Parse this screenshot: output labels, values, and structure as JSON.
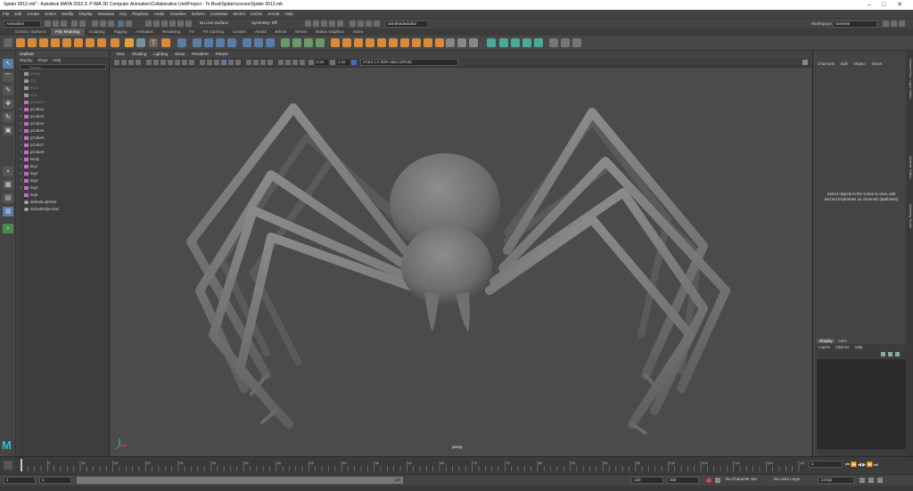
{
  "window": {
    "title": "Spider 0012.mb* - Autodesk MAYA 2022.3: P:\\MA 3D Computer Animation\\Collaborative Unit\\Project - To Beat\\Spider\\scenes\\Spider 0012.mb"
  },
  "menubar": [
    "File",
    "Edit",
    "Create",
    "Select",
    "Modify",
    "Display",
    "Windows",
    "Key",
    "Playback",
    "Audio",
    "Visualize",
    "Deform",
    "Constrain",
    "MASH",
    "Cache",
    "Arnold",
    "Help"
  ],
  "statusline": {
    "mode": "Animation",
    "live_surface": "No Live Surface",
    "symmetry": "Symmetry: Off",
    "user": "dorothedwards2",
    "workspace_label": "Workspace :",
    "workspace": "General"
  },
  "shelf_tabs": [
    "Curves / Surfaces",
    "Poly Modeling",
    "Sculpting",
    "Rigging",
    "Animation",
    "Rendering",
    "FX",
    "FX Caching",
    "Custom",
    "Arnold",
    "Bifrost",
    "MASH",
    "Motion Graphics",
    "XGen"
  ],
  "shelf_active": "Poly Modeling",
  "outliner": {
    "title": "Outliner",
    "menu": [
      "Display",
      "Show",
      "Help"
    ],
    "search_placeholder": "Search...",
    "items": [
      {
        "label": "persp",
        "dim": true,
        "icon": "camera-icon",
        "expandable": false
      },
      {
        "label": "top",
        "dim": true,
        "icon": "camera-icon",
        "expandable": false
      },
      {
        "label": "front",
        "dim": true,
        "icon": "camera-icon",
        "expandable": false
      },
      {
        "label": "side",
        "dim": true,
        "icon": "camera-icon",
        "expandable": false
      },
      {
        "label": "pCube1",
        "dim": true,
        "icon": "mesh-icon",
        "expandable": false
      },
      {
        "label": "pCube2",
        "dim": false,
        "icon": "mesh-icon",
        "expandable": true
      },
      {
        "label": "pCube3",
        "dim": false,
        "icon": "mesh-icon",
        "expandable": true
      },
      {
        "label": "pCube4",
        "dim": false,
        "icon": "mesh-icon",
        "expandable": true
      },
      {
        "label": "pCube5",
        "dim": false,
        "icon": "mesh-icon",
        "expandable": true
      },
      {
        "label": "pCube6",
        "dim": false,
        "icon": "mesh-icon",
        "expandable": true
      },
      {
        "label": "pCube7",
        "dim": false,
        "icon": "mesh-icon",
        "expandable": true
      },
      {
        "label": "pCube8",
        "dim": false,
        "icon": "mesh-icon",
        "expandable": true
      },
      {
        "label": "Body",
        "dim": false,
        "icon": "mesh-icon",
        "expandable": true
      },
      {
        "label": "leg1",
        "dim": false,
        "icon": "mesh-icon",
        "expandable": true
      },
      {
        "label": "leg2",
        "dim": false,
        "icon": "mesh-icon",
        "expandable": true
      },
      {
        "label": "leg3",
        "dim": false,
        "icon": "mesh-icon",
        "expandable": true
      },
      {
        "label": "leg4",
        "dim": false,
        "icon": "mesh-icon",
        "expandable": true
      },
      {
        "label": "leg5",
        "dim": false,
        "icon": "mesh-icon",
        "expandable": false
      },
      {
        "label": "defaultLightSet",
        "dim": false,
        "icon": "set-icon",
        "expandable": false
      },
      {
        "label": "defaultObjectSet",
        "dim": false,
        "icon": "set-icon",
        "expandable": false
      }
    ]
  },
  "viewport": {
    "menu": [
      "View",
      "Shading",
      "Lighting",
      "Show",
      "Renderer",
      "Panels"
    ],
    "exposure": "0.00",
    "gamma": "1.00",
    "color_space": "ACES 1.0 SDR-video (sRGB)",
    "camera_label": "persp"
  },
  "channel_box": {
    "menu": [
      "Channels",
      "Edit",
      "Object",
      "Show"
    ],
    "message": "Select objects in the scene to view, edit and set keyframes on channels (attributes)"
  },
  "layer_editor": {
    "tabs": [
      "Display",
      "Anim"
    ],
    "active_tab": "Display",
    "menu": [
      "Layers",
      "Options",
      "Help"
    ]
  },
  "right_tabs": [
    "Channel Box / Layer Editor",
    "Attribute Editor",
    "Modeling Toolkit"
  ],
  "timeline": {
    "ticks": [
      "5",
      "10",
      "15",
      "20",
      "25",
      "30",
      "35",
      "40",
      "45",
      "50",
      "55",
      "60",
      "65",
      "70",
      "75",
      "80",
      "85",
      "90",
      "95",
      "100",
      "105",
      "110",
      "115",
      "120"
    ],
    "current_frame": "1"
  },
  "range": {
    "start": "1",
    "playback_start": "1",
    "range_end_label": "120",
    "playback_end": "120",
    "end": "200",
    "character_set": "No Character Set",
    "anim_layer": "No Anim Layer",
    "fps": "24 fps"
  }
}
